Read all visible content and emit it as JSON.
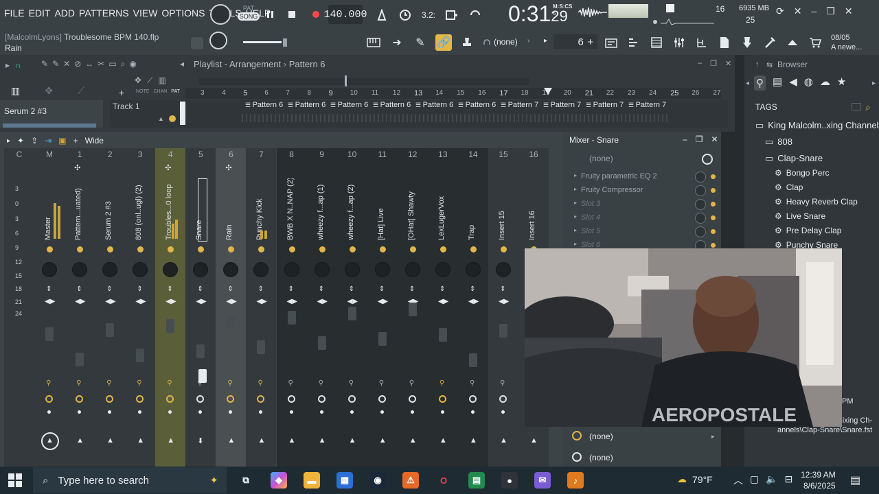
{
  "menu": [
    "FILE",
    "EDIT",
    "ADD",
    "PATTERNS",
    "VIEW",
    "OPTIONS",
    "TOOLS",
    "HELP"
  ],
  "transport": {
    "pat_label": "PAT",
    "song_label": "SONG",
    "tempo": "140.000",
    "time_main": "0:31",
    "time_sub": "29",
    "time_unit": "M:S:CS",
    "time_ms": "5"
  },
  "project": {
    "author": "[MalcolmLyons]",
    "filename": "Troublesome BPM 140.flp",
    "hint": "Rain"
  },
  "stats": {
    "voices": "16",
    "memory": "6935 MB",
    "cpu": "25"
  },
  "toolbar": {
    "none_label": "(none)",
    "pattern_number": "6",
    "pattern_plus": "+",
    "news_date": "08/05",
    "news_text": "A newe..."
  },
  "playlist": {
    "title": "Playlist - Arrangement",
    "separator": "›",
    "pattern": "Pattern 6",
    "note_label": "NOTE",
    "chan_label": "CHAN",
    "pat_label": "PAT",
    "track_left_label": "Serum 2 #3",
    "track_name": "Track 1",
    "ruler": [
      "3",
      "4",
      "5",
      "6",
      "7",
      "8",
      "9",
      "10",
      "11",
      "12",
      "13",
      "14",
      "15",
      "16",
      "17",
      "18",
      "19",
      "20",
      "21",
      "22",
      "23",
      "24",
      "25",
      "26",
      "27"
    ],
    "clips": [
      "Pattern 6",
      "Pattern 6",
      "Pattern 6",
      "Pattern 6",
      "Pattern 6",
      "Pattern 6",
      "Pattern 7",
      "Pattern 7",
      "Pattern 7",
      "Pattern 7"
    ]
  },
  "mixer": {
    "view_label": "Wide",
    "channels": [
      {
        "num": "C",
        "name": ""
      },
      {
        "num": "M",
        "name": "Master"
      },
      {
        "num": "1",
        "name": "Pattern...uated)"
      },
      {
        "num": "2",
        "name": "Serum 2 #3"
      },
      {
        "num": "3",
        "name": "808 (onl..ugl) (2)"
      },
      {
        "num": "4",
        "name": "Troubles...0 loop"
      },
      {
        "num": "5",
        "name": "Snare"
      },
      {
        "num": "6",
        "name": "Rain"
      },
      {
        "num": "7",
        "name": "Punchy Kick"
      },
      {
        "num": "8",
        "name": "BWB X N..NAP (2)"
      },
      {
        "num": "9",
        "name": "wheezy f...ap (1)"
      },
      {
        "num": "10",
        "name": "wheezy f...ap (2)"
      },
      {
        "num": "11",
        "name": "[Hat] Live"
      },
      {
        "num": "12",
        "name": "[OHat] Shawty"
      },
      {
        "num": "13",
        "name": "LexLugerVox"
      },
      {
        "num": "14",
        "name": "Trap"
      },
      {
        "num": "15",
        "name": "Insert 15"
      },
      {
        "num": "16",
        "name": "Insert 16"
      }
    ],
    "db_scale": [
      "3",
      "0",
      "3",
      "6",
      "9",
      "12",
      "15",
      "18",
      "21",
      "24"
    ]
  },
  "insert_panel": {
    "title": "Mixer - Snare",
    "top_none": "(none)",
    "slots": [
      "Fruity parametric EQ 2",
      "Fruity Compressor",
      "Slot 3",
      "Slot 4",
      "Slot 5",
      "Slot 6"
    ],
    "out_none_1": "(none)",
    "out_none_2": "(none)"
  },
  "browser": {
    "title": "Browser",
    "tags_label": "TAGS",
    "root_folder": "King Malcolm..xing Channels",
    "folders": [
      "808",
      "Clap-Snare"
    ],
    "presets": [
      "Bongo Perc",
      "Clap",
      "Heavy Reverb Clap",
      "Live Snare",
      "Pre Delay Clap",
      "Punchy Snare"
    ],
    "time_fragment": "PM",
    "path_line1": "ixing Ch-",
    "path_line2": "annels\\Clap-Snare\\Snare.fst"
  },
  "taskbar": {
    "search_placeholder": "Type here to search",
    "weather": "79°F",
    "time": "12:39 AM",
    "date": "8/6/2025"
  },
  "colors": {
    "accent_yellow": "#e0b54a",
    "record_red": "#ff4747",
    "selected_strip": "#5a5f3a"
  }
}
